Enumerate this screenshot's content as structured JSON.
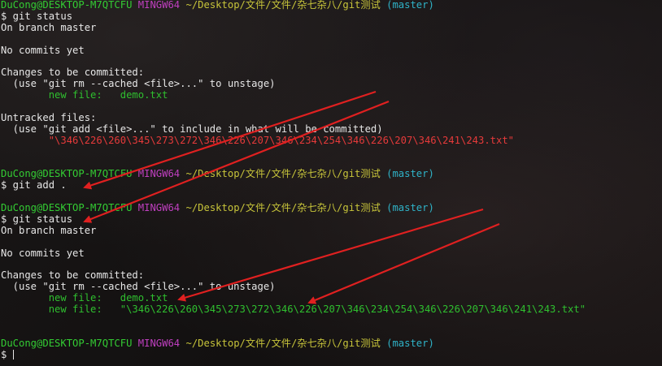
{
  "prompt": {
    "user_host": "DuCong@DESKTOP-M7QTCFU",
    "shell": "MINGW64",
    "path": "~/Desktop/文件/文件/杂七杂八/git测试",
    "branch": "(master)"
  },
  "lines": [
    {
      "type": "prompt"
    },
    {
      "type": "text",
      "text": "$ git status"
    },
    {
      "type": "text",
      "text": "On branch master"
    },
    {
      "type": "blank"
    },
    {
      "type": "text",
      "text": "No commits yet"
    },
    {
      "type": "blank"
    },
    {
      "type": "text",
      "text": "Changes to be committed:"
    },
    {
      "type": "text",
      "text": "  (use \"git rm --cached <file>...\" to unstage)"
    },
    {
      "type": "green",
      "text": "        new file:   demo.txt"
    },
    {
      "type": "blank"
    },
    {
      "type": "text",
      "text": "Untracked files:"
    },
    {
      "type": "text",
      "text": "  (use \"git add <file>...\" to include in what will be committed)"
    },
    {
      "type": "red",
      "text": "        \"\\346\\226\\260\\345\\273\\272\\346\\226\\207\\346\\234\\254\\346\\226\\207\\346\\241\\243.txt\""
    },
    {
      "type": "blank"
    },
    {
      "type": "blank"
    },
    {
      "type": "prompt"
    },
    {
      "type": "text",
      "text": "$ git add ."
    },
    {
      "type": "blank"
    },
    {
      "type": "prompt"
    },
    {
      "type": "text",
      "text": "$ git status"
    },
    {
      "type": "text",
      "text": "On branch master"
    },
    {
      "type": "blank"
    },
    {
      "type": "text",
      "text": "No commits yet"
    },
    {
      "type": "blank"
    },
    {
      "type": "text",
      "text": "Changes to be committed:"
    },
    {
      "type": "text",
      "text": "  (use \"git rm --cached <file>...\" to unstage)"
    },
    {
      "type": "green",
      "text": "        new file:   demo.txt"
    },
    {
      "type": "green",
      "text": "        new file:   \"\\346\\226\\260\\345\\273\\272\\346\\226\\207\\346\\234\\254\\346\\226\\207\\346\\241\\243.txt\""
    },
    {
      "type": "blank"
    },
    {
      "type": "blank"
    },
    {
      "type": "prompt"
    },
    {
      "type": "input",
      "text": "$ "
    }
  ],
  "colors": {
    "arrow": "#e02020"
  }
}
